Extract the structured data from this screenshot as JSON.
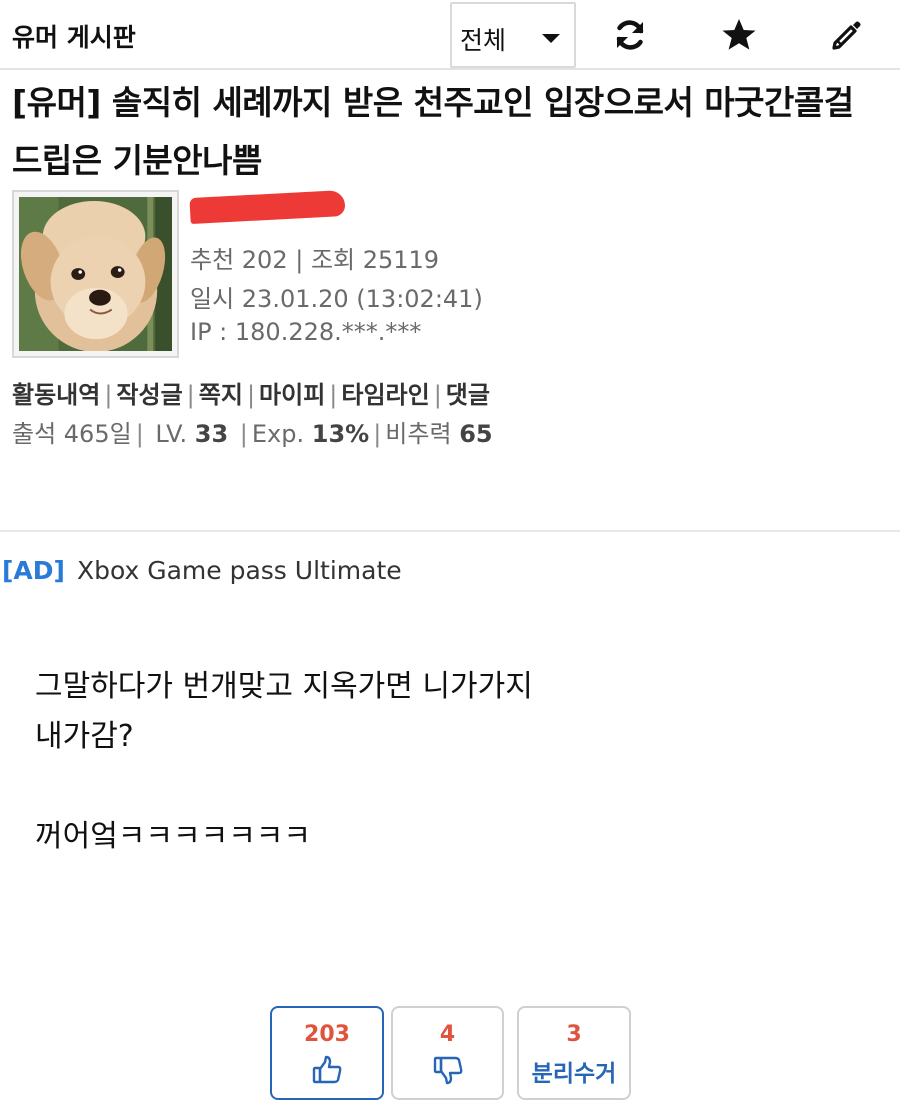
{
  "header": {
    "board_title": "유머 게시판",
    "filter": {
      "selected": "전체"
    },
    "icons": [
      "refresh-icon",
      "star-icon",
      "pencil-icon"
    ]
  },
  "post": {
    "title": "[유머] 솔직히 세례까지 받은 천주교인 입장으로서 마굿간콜걸 드립은 기분안나쁨",
    "author": {
      "name": "",
      "meta_recommend": "추천 202 | 조회 25119",
      "meta_date": "일시 23.01.20 (13:02:41)",
      "meta_ip": "IP : 180.228.***.***"
    },
    "links": [
      "활동내역",
      "작성글",
      "쪽지",
      "마이피",
      "타임라인",
      "댓글"
    ],
    "stats": {
      "attendance": "출석 465일",
      "level_label": "LV.",
      "level": "33",
      "exp_label": "Exp.",
      "exp": "13%",
      "power_label": "비추력",
      "power": "65"
    },
    "ad": {
      "tag": "[AD]",
      "text": "Xbox Game pass Ultimate"
    },
    "body": {
      "line1": "그말하다가 번개맞고 지옥가면 니가가지",
      "line2": "내가감?",
      "line3": "꺼어엌ㅋㅋㅋㅋㅋㅋㅋ"
    },
    "votes": {
      "up": "203",
      "down": "4",
      "recycle_count": "3",
      "recycle_label": "분리수거"
    }
  },
  "colors": {
    "accent_blue": "#2766b7",
    "ad_blue": "#2a7ad8",
    "count_red": "#e0533d",
    "redaction": "#ee3a36"
  }
}
